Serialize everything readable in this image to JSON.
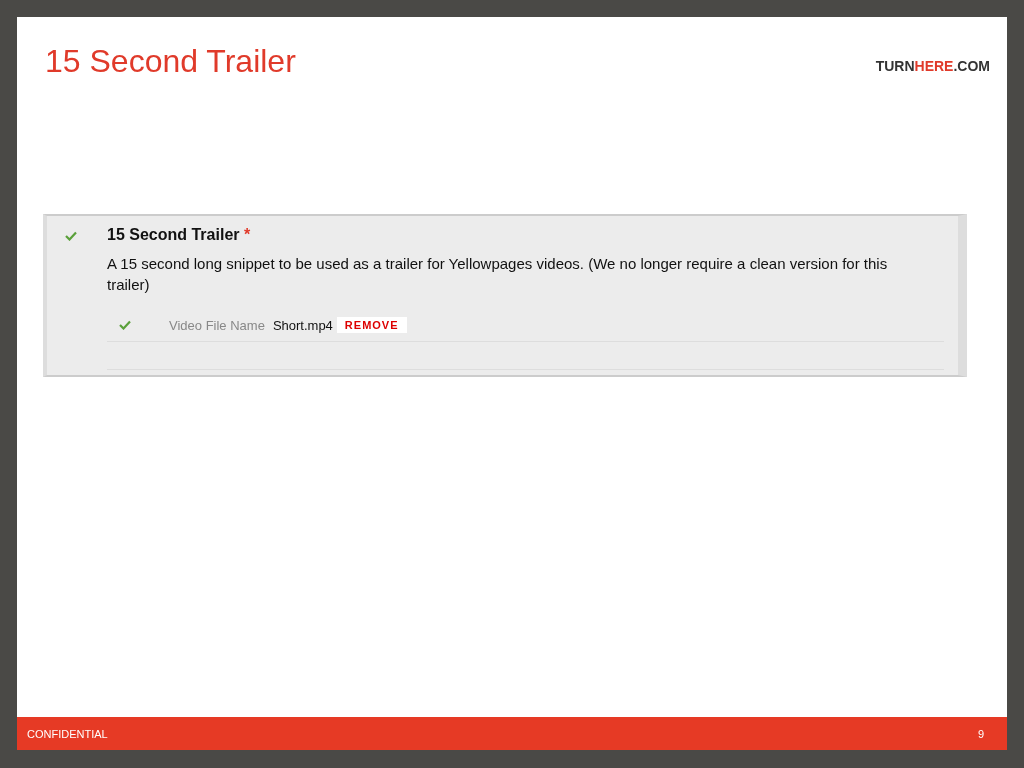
{
  "slide": {
    "title": "15 Second Trailer",
    "logo": [
      {
        "text": "TURN",
        "highlight": false
      },
      {
        "text": "HERE",
        "highlight": true
      },
      {
        "text": ".COM",
        "highlight": false
      }
    ],
    "field": {
      "complete": true,
      "title": "15 Second Trailer",
      "required_mark": "*",
      "description": "A 15 second long snippet to be used as a trailer for Yellowpages videos. (We no longer require a clean version for this trailer)",
      "file": {
        "complete": true,
        "label": "Video File Name",
        "value": "Short.mp4",
        "action": "REMOVE"
      }
    },
    "footer": {
      "label": "CONFIDENTIAL",
      "page": "9"
    }
  }
}
